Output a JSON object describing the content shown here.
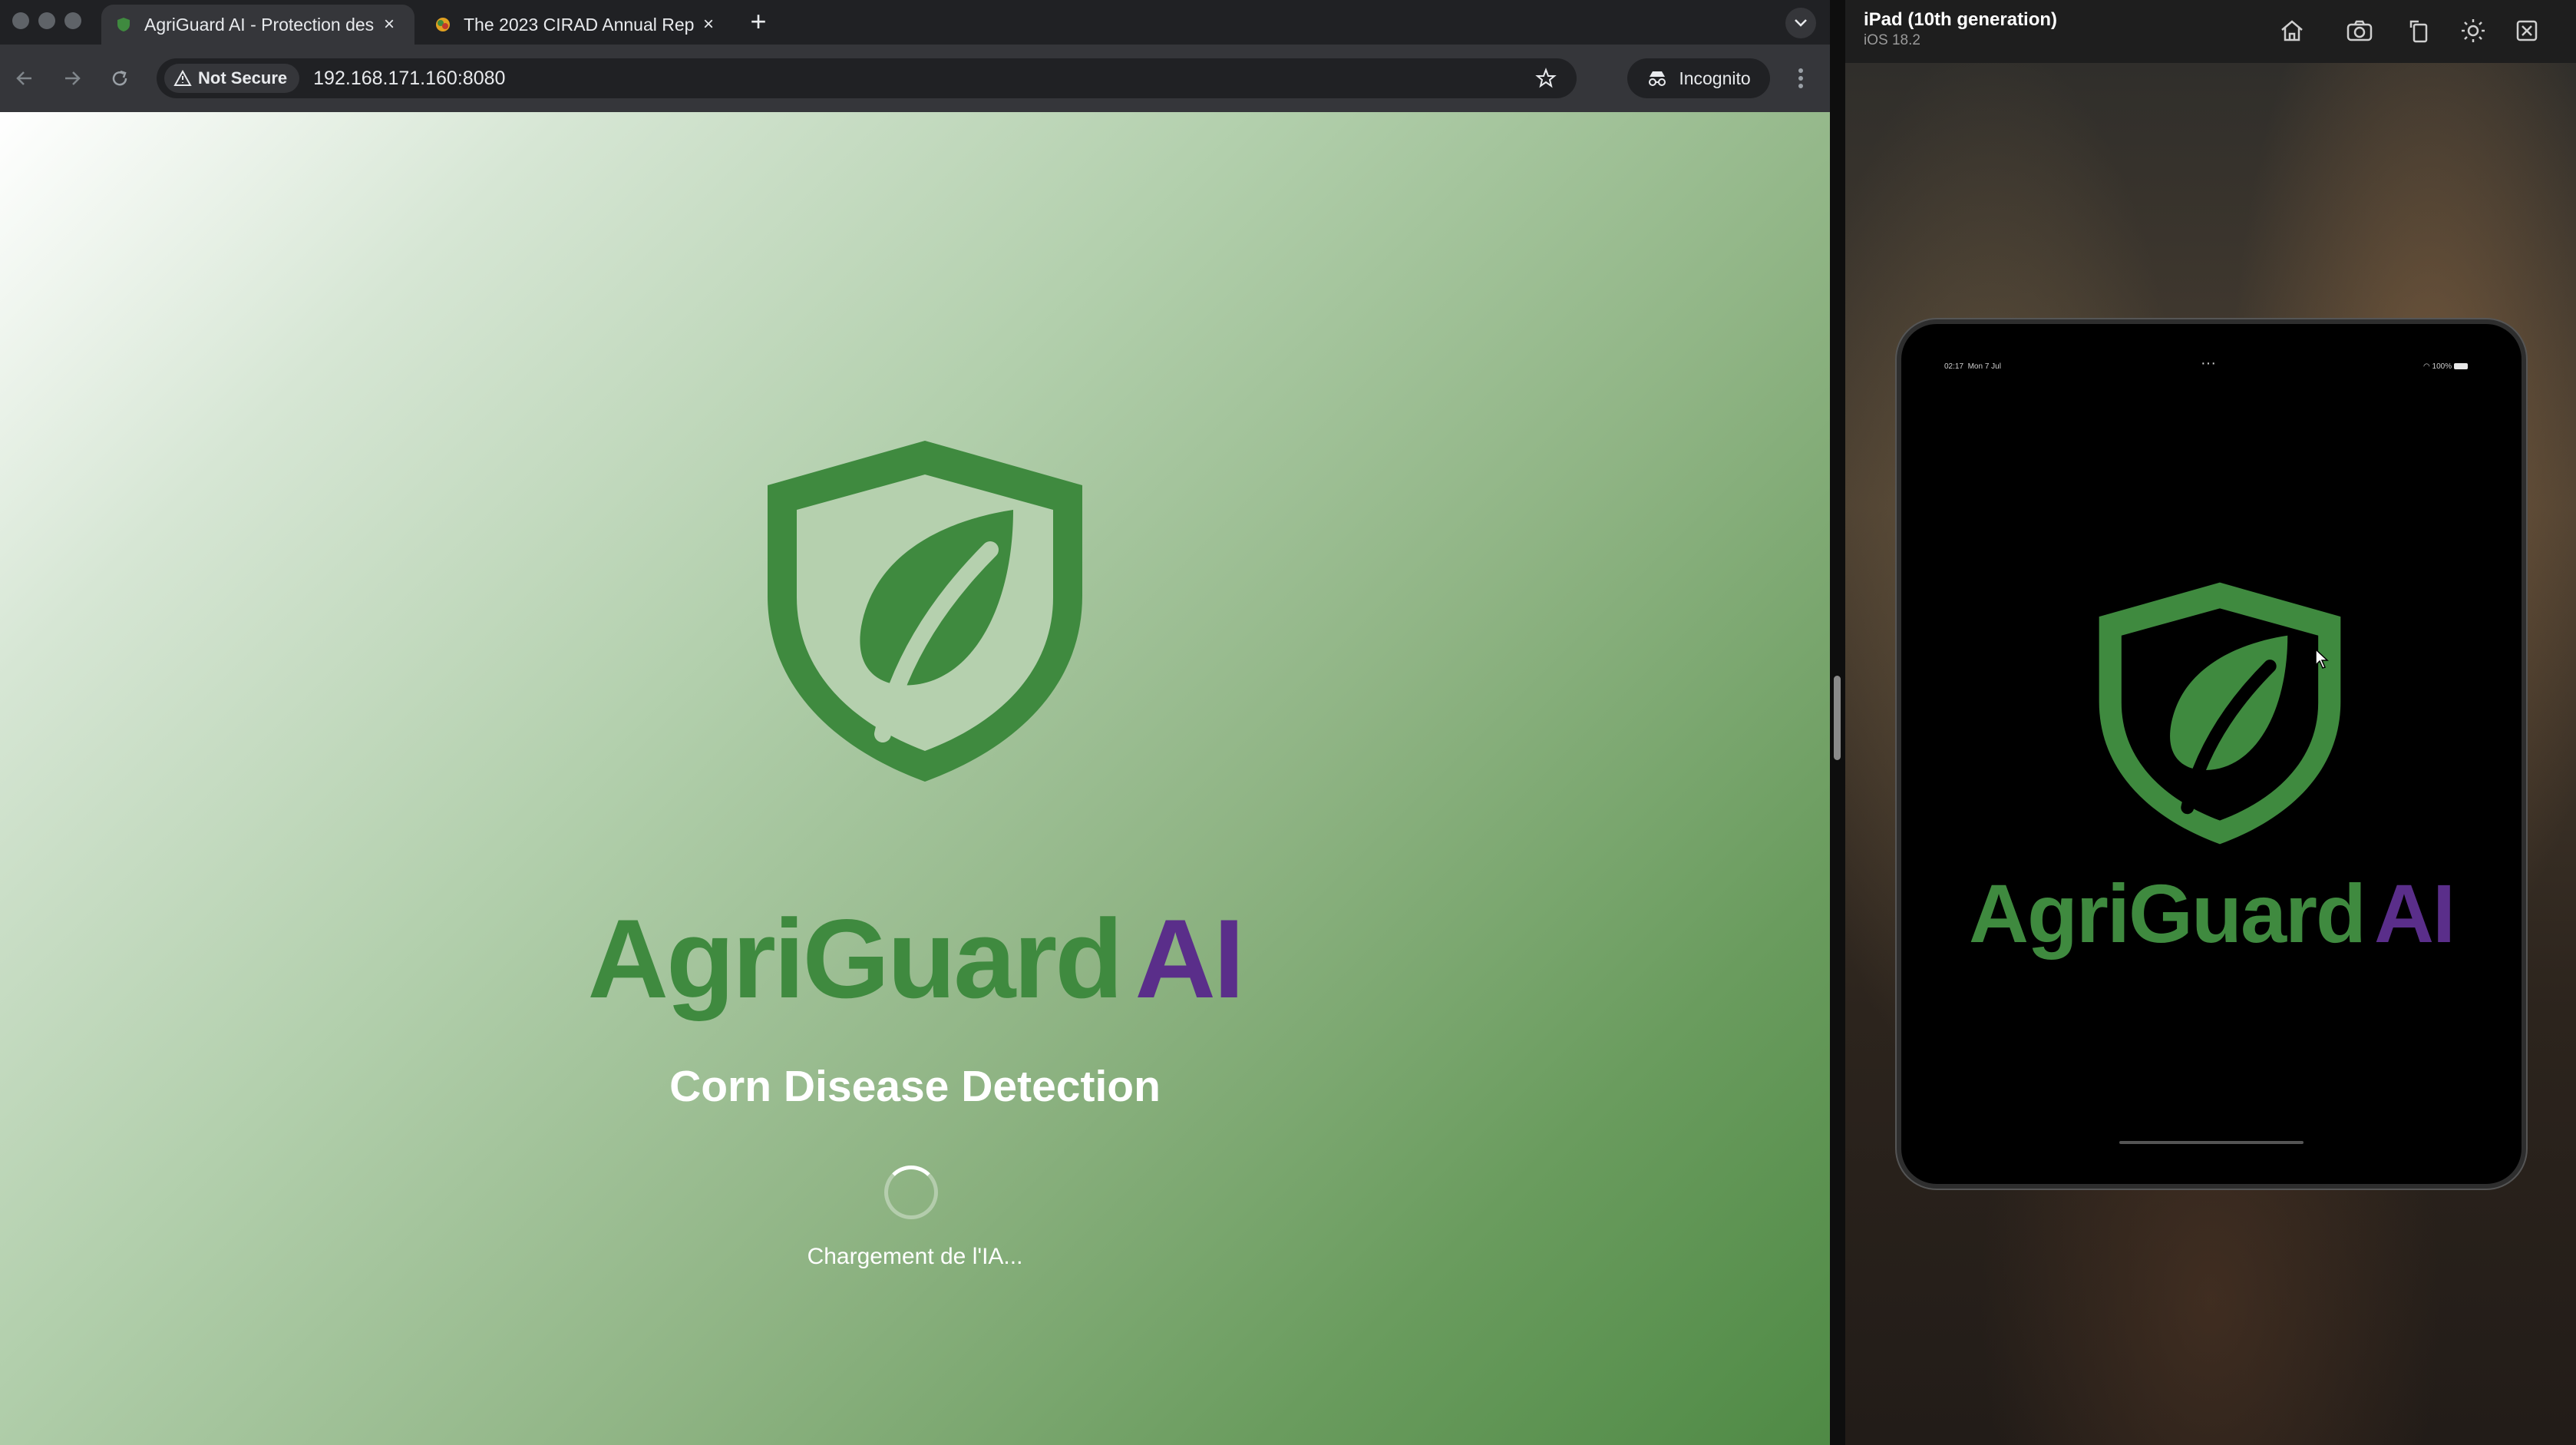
{
  "browser": {
    "tabs": [
      {
        "title": "AgriGuard AI - Protection des",
        "active": true
      },
      {
        "title": "The 2023 CIRAD Annual Rep",
        "active": false
      }
    ],
    "security_label": "Not Secure",
    "url": "192.168.171.160:8080",
    "incognito_label": "Incognito"
  },
  "page": {
    "brand_main": "AgriGuard",
    "brand_accent": "AI",
    "subtitle": "Corn Disease Detection",
    "loading_text": "Chargement de l'IA..."
  },
  "simulator": {
    "device_name": "iPad (10th generation)",
    "os_version": "iOS 18.2",
    "status_time": "02:17",
    "status_date": "Mon 7 Jul",
    "battery": "100%",
    "brand_main": "AgriGuard",
    "brand_accent": "AI"
  },
  "colors": {
    "brand_green": "#3f8a3f",
    "brand_purple": "#5a2e8a",
    "browser_chrome": "#35363a"
  },
  "icons": [
    "back-icon",
    "forward-icon",
    "reload-icon",
    "warning-icon",
    "star-icon",
    "incognito-icon",
    "kebab-icon",
    "home-icon",
    "screenshot-icon",
    "rotate-icon",
    "brightness-icon",
    "close-window-icon"
  ]
}
